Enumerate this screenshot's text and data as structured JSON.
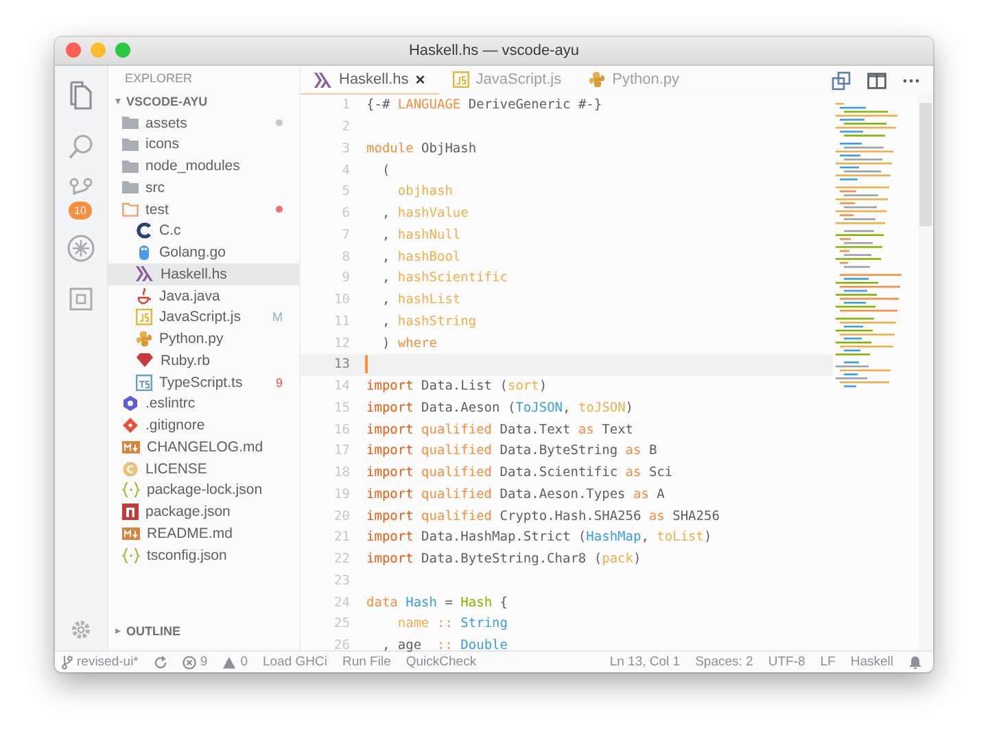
{
  "window": {
    "title": "Haskell.hs — vscode-ayu"
  },
  "activity_bar": [
    {
      "kind": "files"
    },
    {
      "kind": "search"
    },
    {
      "kind": "source-control",
      "badge": "10"
    },
    {
      "kind": "debug"
    },
    {
      "kind": "extensions"
    }
  ],
  "activity_bottom": {
    "kind": "settings"
  },
  "sidebar": {
    "title": "EXPLORER",
    "root": {
      "name": "VSCODE-AYU",
      "expanded": true,
      "children": [
        {
          "name": "assets",
          "kind": "folder",
          "expanded": false,
          "selected": false,
          "color": "#c8c8c8"
        },
        {
          "name": "icons",
          "kind": "folder",
          "expanded": false,
          "selected": false
        },
        {
          "name": "node_modules",
          "kind": "folder",
          "expanded": false,
          "selected": false
        },
        {
          "name": "src",
          "kind": "folder",
          "expanded": false,
          "selected": false
        },
        {
          "name": "test",
          "kind": "folder",
          "expanded": true,
          "selected": false,
          "color": "#f07171",
          "children": [
            {
              "name": "C.c",
              "kind": "c",
              "selected": false
            },
            {
              "name": "Golang.go",
              "kind": "go",
              "selected": false
            },
            {
              "name": "Haskell.hs",
              "kind": "haskell",
              "selected": true
            },
            {
              "name": "Java.java",
              "kind": "java",
              "selected": false
            },
            {
              "name": "JavaScript.js",
              "kind": "js",
              "selected": false,
              "badge": "M",
              "color": "#8fb0c8"
            },
            {
              "name": "Python.py",
              "kind": "python",
              "selected": false
            },
            {
              "name": "Ruby.rb",
              "kind": "ruby",
              "selected": false
            },
            {
              "name": "TypeScript.ts",
              "kind": "ts",
              "selected": false,
              "badge": "9",
              "color": "#e65050"
            }
          ]
        },
        {
          "name": ".eslintrc",
          "kind": "eslint",
          "selected": false
        },
        {
          "name": ".gitignore",
          "kind": "git",
          "selected": false
        },
        {
          "name": "CHANGELOG.md",
          "kind": "markdown",
          "selected": false
        },
        {
          "name": "LICENSE",
          "kind": "license",
          "selected": false
        },
        {
          "name": "package-lock.json",
          "kind": "json",
          "selected": false
        },
        {
          "name": "package.json",
          "kind": "npm",
          "selected": false
        },
        {
          "name": "README.md",
          "kind": "markdown",
          "selected": false
        },
        {
          "name": "tsconfig.json",
          "kind": "json",
          "selected": false
        }
      ]
    },
    "outline": {
      "name": "OUTLINE",
      "expanded": false
    }
  },
  "tabs": [
    {
      "label": "Haskell.hs",
      "kind": "haskell",
      "selected": true,
      "close": "×"
    },
    {
      "label": "JavaScript.js",
      "kind": "js",
      "selected": false
    },
    {
      "label": "Python.py",
      "kind": "python",
      "selected": false
    }
  ],
  "editor": {
    "lines": [
      {
        "number": "1",
        "current": false,
        "tokens": [
          {
            "text": "{-# ",
            "kind": "plain"
          },
          {
            "text": "LANGUAGE",
            "kind": "keyword"
          },
          {
            "text": " DeriveGeneric #-}",
            "kind": "plain"
          }
        ]
      },
      {
        "number": "2",
        "current": false
      },
      {
        "number": "3",
        "current": false,
        "tokens": [
          {
            "text": "module",
            "kind": "keyword"
          },
          {
            "text": " ObjHash",
            "kind": "plain"
          }
        ]
      },
      {
        "number": "4",
        "current": false,
        "tokens": [
          {
            "text": "  (",
            "kind": "plain"
          }
        ]
      },
      {
        "number": "5",
        "current": false,
        "tokens": [
          {
            "text": "    objhash",
            "kind": "function"
          }
        ]
      },
      {
        "number": "6",
        "current": false,
        "tokens": [
          {
            "text": "  , ",
            "kind": "plain"
          },
          {
            "text": "hashValue",
            "kind": "function"
          }
        ]
      },
      {
        "number": "7",
        "current": false,
        "tokens": [
          {
            "text": "  , ",
            "kind": "plain"
          },
          {
            "text": "hashNull",
            "kind": "function"
          }
        ]
      },
      {
        "number": "8",
        "current": false,
        "tokens": [
          {
            "text": "  , ",
            "kind": "plain"
          },
          {
            "text": "hashBool",
            "kind": "function"
          }
        ]
      },
      {
        "number": "9",
        "current": false,
        "tokens": [
          {
            "text": "  , ",
            "kind": "plain"
          },
          {
            "text": "hashScientific",
            "kind": "function"
          }
        ]
      },
      {
        "number": "10",
        "current": false,
        "tokens": [
          {
            "text": "  , ",
            "kind": "plain"
          },
          {
            "text": "hashList",
            "kind": "function"
          }
        ]
      },
      {
        "number": "11",
        "current": false,
        "tokens": [
          {
            "text": "  , ",
            "kind": "plain"
          },
          {
            "text": "hashString",
            "kind": "function"
          }
        ]
      },
      {
        "number": "12",
        "current": false,
        "tokens": [
          {
            "text": "  ) ",
            "kind": "plain"
          },
          {
            "text": "where",
            "kind": "keyword"
          }
        ]
      },
      {
        "number": "13",
        "current": true
      },
      {
        "number": "14",
        "current": false,
        "tokens": [
          {
            "text": "import",
            "kind": "import"
          },
          {
            "text": " Data.List (",
            "kind": "plain"
          },
          {
            "text": "sort",
            "kind": "function"
          },
          {
            "text": ")",
            "kind": "plain"
          }
        ]
      },
      {
        "number": "15",
        "current": false,
        "tokens": [
          {
            "text": "import",
            "kind": "import"
          },
          {
            "text": " Data.Aeson (",
            "kind": "plain"
          },
          {
            "text": "ToJSON",
            "kind": "type"
          },
          {
            "text": ", ",
            "kind": "plain"
          },
          {
            "text": "toJSON",
            "kind": "function"
          },
          {
            "text": ")",
            "kind": "plain"
          }
        ]
      },
      {
        "number": "16",
        "current": false,
        "tokens": [
          {
            "text": "import",
            "kind": "import"
          },
          {
            "text": " qualified",
            "kind": "keyword"
          },
          {
            "text": " Data.Text ",
            "kind": "plain"
          },
          {
            "text": "as",
            "kind": "keyword"
          },
          {
            "text": " Text",
            "kind": "plain"
          }
        ]
      },
      {
        "number": "17",
        "current": false,
        "tokens": [
          {
            "text": "import",
            "kind": "import"
          },
          {
            "text": " qualified",
            "kind": "keyword"
          },
          {
            "text": " Data.ByteString ",
            "kind": "plain"
          },
          {
            "text": "as",
            "kind": "keyword"
          },
          {
            "text": " B",
            "kind": "plain"
          }
        ]
      },
      {
        "number": "18",
        "current": false,
        "tokens": [
          {
            "text": "import",
            "kind": "import"
          },
          {
            "text": " qualified",
            "kind": "keyword"
          },
          {
            "text": " Data.Scientific ",
            "kind": "plain"
          },
          {
            "text": "as",
            "kind": "keyword"
          },
          {
            "text": " Sci",
            "kind": "plain"
          }
        ]
      },
      {
        "number": "19",
        "current": false,
        "tokens": [
          {
            "text": "import",
            "kind": "import"
          },
          {
            "text": " qualified",
            "kind": "keyword"
          },
          {
            "text": " Data.Aeson.Types ",
            "kind": "plain"
          },
          {
            "text": "as",
            "kind": "keyword"
          },
          {
            "text": " A",
            "kind": "plain"
          }
        ]
      },
      {
        "number": "20",
        "current": false,
        "tokens": [
          {
            "text": "import",
            "kind": "import"
          },
          {
            "text": " qualified",
            "kind": "keyword"
          },
          {
            "text": " Crypto.Hash.SHA256 ",
            "kind": "plain"
          },
          {
            "text": "as",
            "kind": "keyword"
          },
          {
            "text": " SHA256",
            "kind": "plain"
          }
        ]
      },
      {
        "number": "21",
        "current": false,
        "tokens": [
          {
            "text": "import",
            "kind": "import"
          },
          {
            "text": " Data.HashMap.Strict (",
            "kind": "plain"
          },
          {
            "text": "HashMap",
            "kind": "type"
          },
          {
            "text": ", ",
            "kind": "plain"
          },
          {
            "text": "toList",
            "kind": "function"
          },
          {
            "text": ")",
            "kind": "plain"
          }
        ]
      },
      {
        "number": "22",
        "current": false,
        "tokens": [
          {
            "text": "import",
            "kind": "import"
          },
          {
            "text": " Data.ByteString.Char8 (",
            "kind": "plain"
          },
          {
            "text": "pack",
            "kind": "function"
          },
          {
            "text": ")",
            "kind": "plain"
          }
        ]
      },
      {
        "number": "23",
        "current": false
      },
      {
        "number": "24",
        "current": false,
        "tokens": [
          {
            "text": "data",
            "kind": "keyword"
          },
          {
            "text": " Hash",
            "kind": "type"
          },
          {
            "text": " = ",
            "kind": "plain"
          },
          {
            "text": "Hash",
            "kind": "constructor"
          },
          {
            "text": " {",
            "kind": "plain"
          }
        ]
      },
      {
        "number": "25",
        "current": false,
        "tokens": [
          {
            "text": "    name",
            "kind": "function"
          },
          {
            "text": " ::",
            "kind": "keyword"
          },
          {
            "text": " String",
            "kind": "type"
          }
        ]
      },
      {
        "number": "26",
        "current": false,
        "tokens": [
          {
            "text": "  , age  ",
            "kind": "plain"
          },
          {
            "text": "::",
            "kind": "keyword"
          },
          {
            "text": " Double",
            "kind": "type"
          }
        ]
      }
    ]
  },
  "status_bar": {
    "left": [
      {
        "kind": "branch",
        "text": "revised-ui*"
      },
      {
        "kind": "sync"
      },
      {
        "kind": "errors",
        "text": "9"
      },
      {
        "kind": "warnings",
        "text": "0"
      },
      {
        "kind": "command",
        "text": "Load GHCi"
      },
      {
        "kind": "command",
        "text": "Run File"
      },
      {
        "kind": "command",
        "text": "QuickCheck"
      }
    ],
    "right": [
      {
        "kind": "command",
        "text": "Ln 13, Col 1"
      },
      {
        "kind": "command",
        "text": "Spaces: 2"
      },
      {
        "kind": "command",
        "text": "UTF-8"
      },
      {
        "kind": "command",
        "text": "LF"
      },
      {
        "kind": "command",
        "text": "Haskell"
      },
      {
        "kind": "bell"
      }
    ]
  }
}
